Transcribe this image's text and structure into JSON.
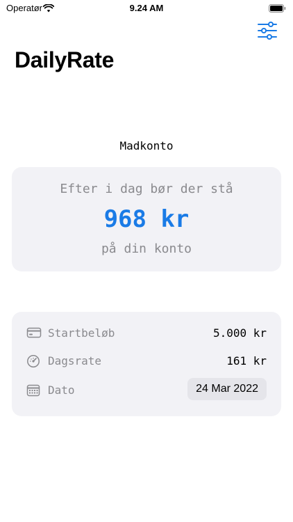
{
  "status_bar": {
    "carrier": "Operatør",
    "time": "9.24 AM"
  },
  "header": {
    "title": "DailyRate",
    "settings_icon": "sliders-icon"
  },
  "account": {
    "name": "Madkonto"
  },
  "balance": {
    "line1": "Efter i dag bør der stå",
    "amount": "968 kr",
    "line3": "på din konto"
  },
  "details": {
    "start_label": "Startbeløb",
    "start_value": "5.000 kr",
    "rate_label": "Dagsrate",
    "rate_value": "161 kr",
    "date_label": "Dato",
    "date_value": "24 Mar 2022"
  },
  "colors": {
    "accent": "#1a7be6",
    "card_bg": "#f2f2f6",
    "secondary_text": "#8a8a8e"
  }
}
